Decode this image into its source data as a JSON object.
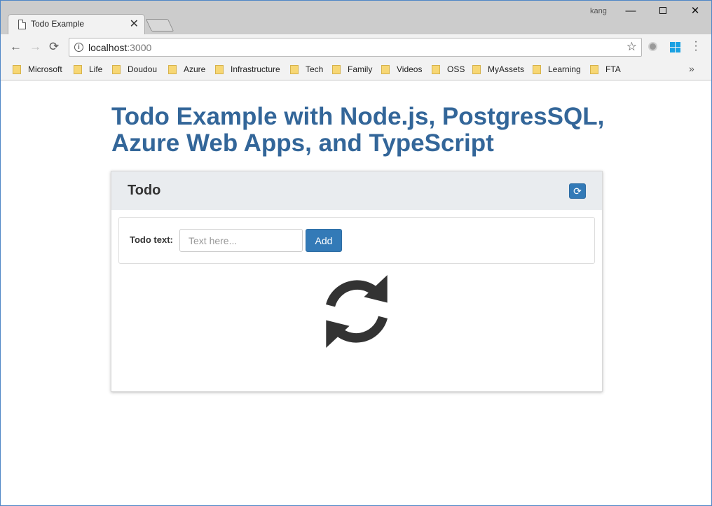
{
  "browser": {
    "tab_title": "Todo Example",
    "tab_close": "✕",
    "user": "kang",
    "url_host": "localhost",
    "url_port": ":3000",
    "window_controls": {
      "minimize": "—",
      "close": "✕"
    },
    "nav": {
      "back": "←",
      "forward": "→",
      "reload": "⟳"
    },
    "star": "☆",
    "bookmarks": [
      "Microsoft",
      "Life",
      "Doudou",
      "Azure",
      "Infrastructure",
      "Tech",
      "Family",
      "Videos",
      "OSS",
      "MyAssets",
      "Learning",
      "FTA"
    ],
    "bookmarks_more": "»"
  },
  "page": {
    "heading_line1": "Todo Example with Node.js, PostgresSQL,",
    "heading_line2": "Azure Web Apps, and TypeScript",
    "panel_title": "Todo",
    "form": {
      "label": "Todo text:",
      "placeholder": "Text here...",
      "add_label": "Add"
    },
    "refresh_glyph": "⟳"
  },
  "colors": {
    "heading": "#336699",
    "primary_button": "#337ab7",
    "panel_header": "#e9ecef",
    "spinner": "#333333"
  }
}
